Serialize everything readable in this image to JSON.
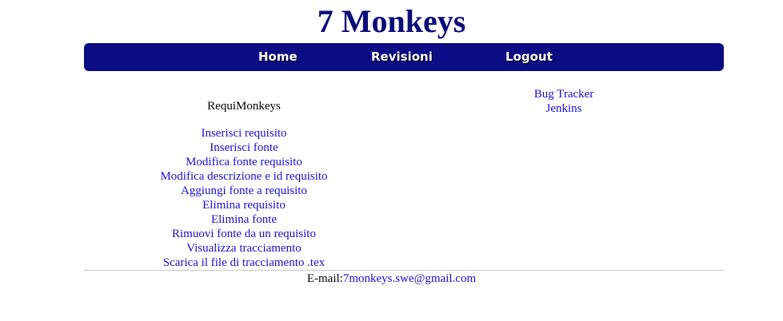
{
  "header": {
    "title": "7 Monkeys"
  },
  "nav": {
    "items": [
      {
        "label": "Home"
      },
      {
        "label": "Revisioni"
      },
      {
        "label": "Logout"
      }
    ]
  },
  "left_panel": {
    "title": "RequiMonkeys",
    "links": [
      {
        "label": "Inserisci requisito"
      },
      {
        "label": "Inserisci fonte"
      },
      {
        "label": "Modifica fonte requisito"
      },
      {
        "label": "Modifica descrizione e id requisito"
      },
      {
        "label": "Aggiungi fonte a requisito"
      },
      {
        "label": "Elimina requisito"
      },
      {
        "label": "Elimina fonte"
      },
      {
        "label": "Rimuovi fonte da un requisito"
      },
      {
        "label": "Visualizza tracciamento"
      },
      {
        "label": "Scarica il file di tracciamento .tex"
      }
    ]
  },
  "right_panel": {
    "links": [
      {
        "label": "Bug Tracker"
      },
      {
        "label": "Jenkins"
      }
    ]
  },
  "footer": {
    "email_label": "E-mail:",
    "email_address": "7monkeys.swe@gmail.com"
  },
  "colors": {
    "title": "#0b0b7a",
    "navbar": "#0c0c85",
    "link": "#1a0dcc",
    "rule": "#c8c8c8"
  }
}
